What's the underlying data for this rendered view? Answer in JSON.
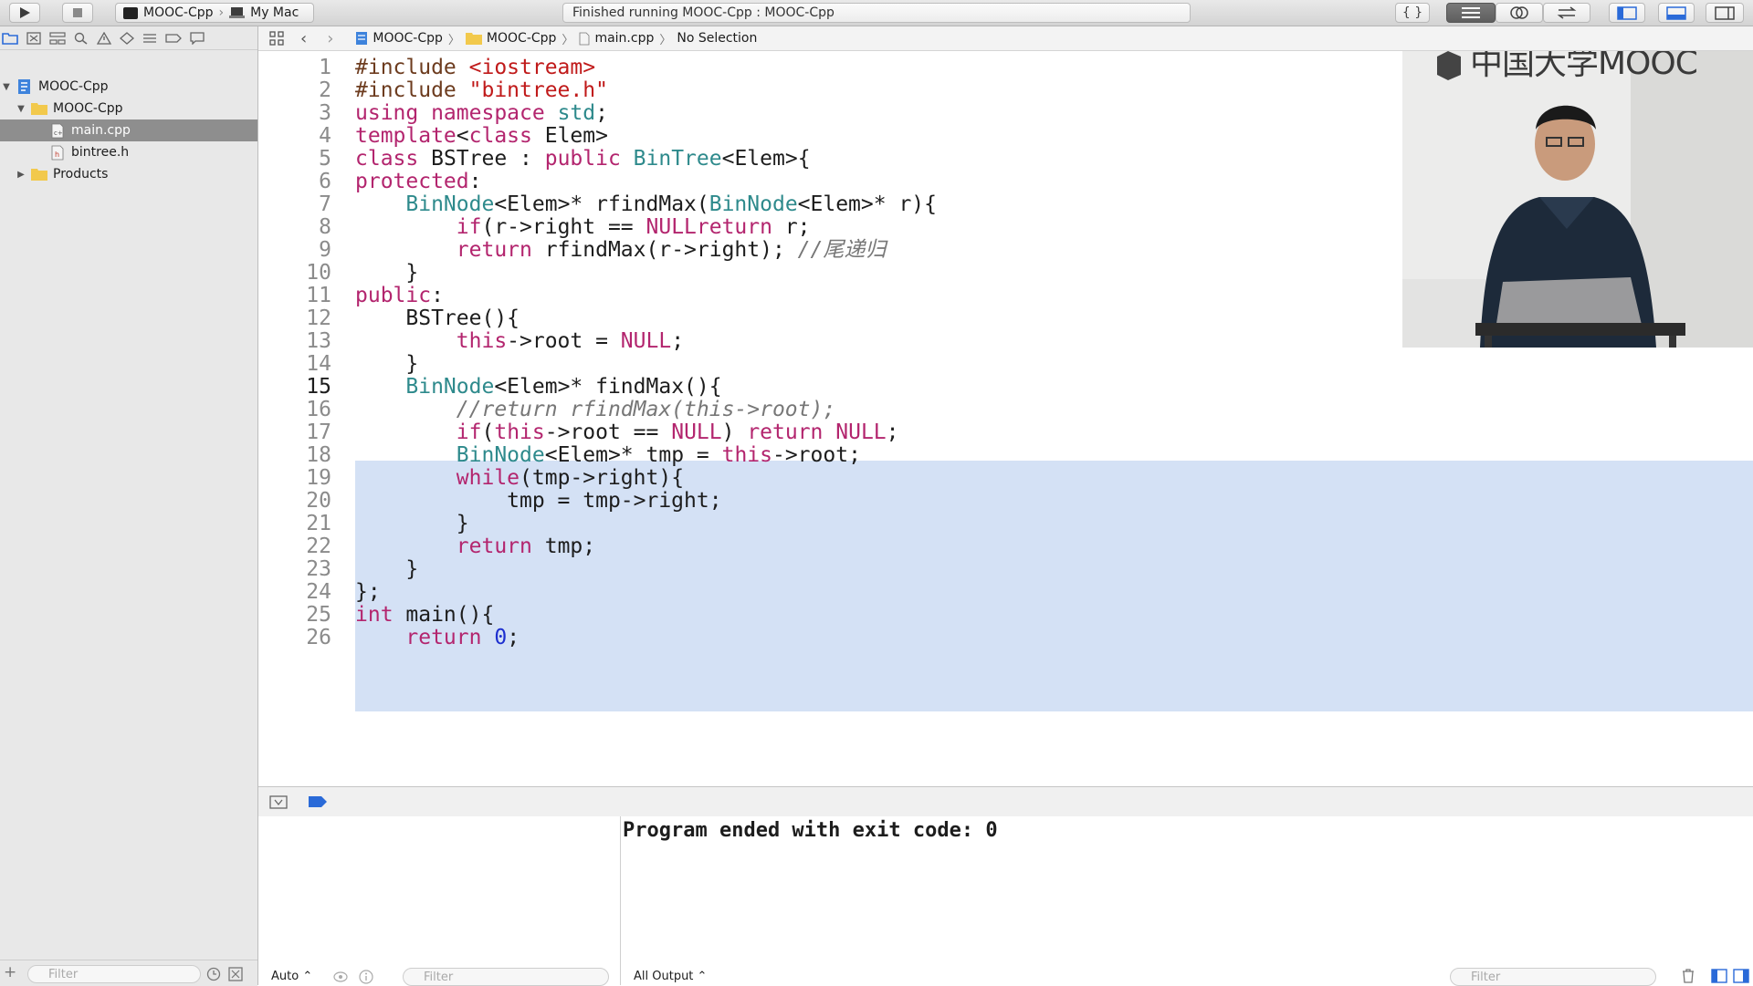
{
  "toolbar": {
    "scheme_target": "MOOC-Cpp",
    "scheme_device": "My Mac",
    "status_text": "Finished running MOOC-Cpp : MOOC-Cpp"
  },
  "navigator": {
    "items": [
      {
        "label": "MOOC-Cpp",
        "kind": "project"
      },
      {
        "label": "MOOC-Cpp",
        "kind": "folder"
      },
      {
        "label": "main.cpp",
        "kind": "cpp-file",
        "selected": true
      },
      {
        "label": "bintree.h",
        "kind": "header-file"
      },
      {
        "label": "Products",
        "kind": "folder"
      }
    ],
    "filter_placeholder": "Filter"
  },
  "jumpbar": {
    "crumbs": [
      "MOOC-Cpp",
      "MOOC-Cpp",
      "main.cpp",
      "No Selection"
    ]
  },
  "editor": {
    "current_line": 15,
    "selection": [
      15,
      23
    ],
    "lines": [
      {
        "n": "1",
        "t": [
          [
            "pp",
            "#include "
          ],
          [
            "st",
            "<iostream>"
          ]
        ]
      },
      {
        "n": "2",
        "t": [
          [
            "pp",
            "#include "
          ],
          [
            "st",
            "\"bintree.h\""
          ]
        ]
      },
      {
        "n": "3",
        "t": [
          [
            "kw",
            "using namespace "
          ],
          [
            "ty",
            "std"
          ],
          [
            "",
            "; "
          ]
        ]
      },
      {
        "n": "4",
        "t": [
          [
            "kw",
            "template"
          ],
          [
            "",
            "<"
          ],
          [
            "kw",
            "class"
          ],
          [
            "",
            " Elem>"
          ]
        ]
      },
      {
        "n": "5",
        "t": [
          [
            "kw",
            "class"
          ],
          [
            "",
            " BSTree : "
          ],
          [
            "kw",
            "public "
          ],
          [
            "ty",
            "BinTree"
          ],
          [
            "",
            "<Elem>{"
          ]
        ]
      },
      {
        "n": "6",
        "t": [
          [
            "kw",
            "protected"
          ],
          [
            "",
            ":"
          ]
        ]
      },
      {
        "n": "7",
        "t": [
          [
            "",
            "    "
          ],
          [
            "ty",
            "BinNode"
          ],
          [
            "",
            "<Elem>* rfindMax("
          ],
          [
            "ty",
            "BinNode"
          ],
          [
            "",
            "<Elem>* r){"
          ]
        ]
      },
      {
        "n": "8",
        "t": [
          [
            "",
            "        "
          ],
          [
            "kw",
            "if"
          ],
          [
            "",
            "(r->right == "
          ],
          [
            "kw",
            "NULL"
          ],
          [
            ") "
          ],
          [
            "kw",
            "return"
          ],
          [
            "",
            " r;"
          ]
        ]
      },
      {
        "n": "9",
        "t": [
          [
            "",
            "        "
          ],
          [
            "kw",
            "return"
          ],
          [
            "",
            " rfindMax(r->right); "
          ],
          [
            "cm",
            "//尾递归"
          ]
        ]
      },
      {
        "n": "10",
        "t": [
          [
            "",
            "    }"
          ]
        ]
      },
      {
        "n": "11",
        "t": [
          [
            "kw",
            "public"
          ],
          [
            "",
            ":"
          ]
        ]
      },
      {
        "n": "12",
        "t": [
          [
            "",
            "    BSTree(){"
          ]
        ]
      },
      {
        "n": "13",
        "t": [
          [
            "",
            "        "
          ],
          [
            "kw",
            "this"
          ],
          [
            "",
            "->root = "
          ],
          [
            "kw",
            "NULL"
          ],
          [
            "",
            ";"
          ]
        ]
      },
      {
        "n": "14",
        "t": [
          [
            "",
            "    }"
          ]
        ]
      },
      {
        "n": "15",
        "t": [
          [
            "",
            "    "
          ],
          [
            "ty",
            "BinNode"
          ],
          [
            "",
            "<Elem>* findMax(){"
          ]
        ]
      },
      {
        "n": "16",
        "t": [
          [
            "",
            "        "
          ],
          [
            "cm",
            "//return rfindMax(this->root);"
          ]
        ]
      },
      {
        "n": "17",
        "t": [
          [
            "",
            "        "
          ],
          [
            "kw",
            "if"
          ],
          [
            "",
            "("
          ],
          [
            "kw",
            "this"
          ],
          [
            "",
            "->root == "
          ],
          [
            "kw",
            "NULL"
          ],
          [
            "",
            ") "
          ],
          [
            "kw",
            "return "
          ],
          [
            "kw",
            "NULL"
          ],
          [
            "",
            ";"
          ]
        ]
      },
      {
        "n": "18",
        "t": [
          [
            "",
            "        "
          ],
          [
            "ty",
            "BinNode"
          ],
          [
            "",
            "<Elem>* tmp = "
          ],
          [
            "kw",
            "this"
          ],
          [
            "",
            "->root;"
          ]
        ]
      },
      {
        "n": "19",
        "t": [
          [
            "",
            "        "
          ],
          [
            "kw",
            "while"
          ],
          [
            "",
            "(tmp->right){"
          ]
        ]
      },
      {
        "n": "20",
        "t": [
          [
            "",
            "            tmp = tmp->right;"
          ]
        ]
      },
      {
        "n": "21",
        "t": [
          [
            "",
            "        }"
          ]
        ]
      },
      {
        "n": "22",
        "t": [
          [
            "",
            "        "
          ],
          [
            "kw",
            "return"
          ],
          [
            "",
            " tmp;"
          ]
        ]
      },
      {
        "n": "23",
        "t": [
          [
            "",
            "    }"
          ]
        ]
      },
      {
        "n": "24",
        "t": [
          [
            "",
            "};"
          ]
        ]
      },
      {
        "n": "25",
        "t": [
          [
            "kw",
            "int"
          ],
          [
            "",
            " main(){"
          ]
        ]
      },
      {
        "n": "26",
        "t": [
          [
            "",
            "    "
          ],
          [
            "kw",
            "return "
          ],
          [
            "nm",
            "0"
          ],
          [
            "",
            ";"
          ]
        ]
      }
    ]
  },
  "debug": {
    "console_output": "Program ended with exit code: 0",
    "vars_mode": "Auto ⌃",
    "vars_filter_placeholder": "Filter",
    "output_mode": "All Output ⌃",
    "console_filter_placeholder": "Filter"
  },
  "overlay": {
    "brand_text": "中国大学MOOC"
  },
  "colors": {
    "keyword": "#b3256e",
    "type": "#2e8a8c",
    "string": "#c01a1a",
    "comment": "#777777",
    "selection": "#d4e1f5",
    "nav_selected": "#8e8e8e"
  }
}
